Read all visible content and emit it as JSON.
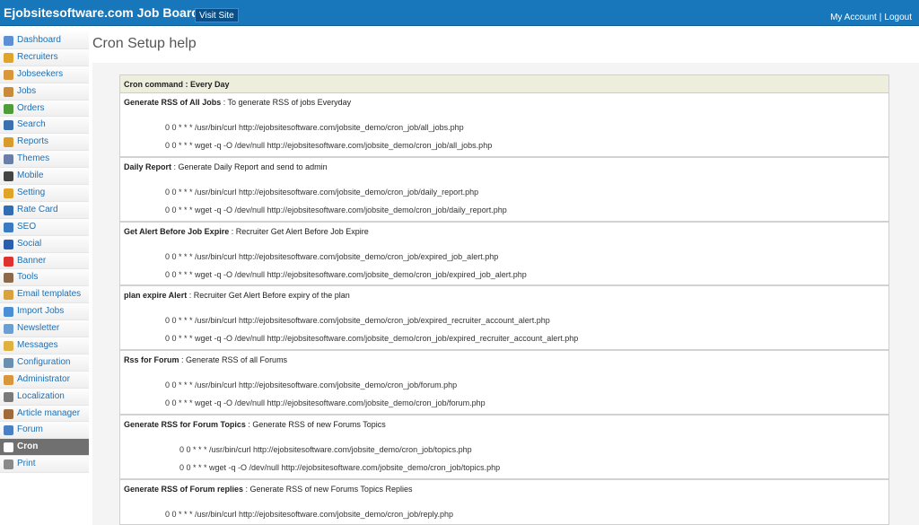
{
  "header": {
    "brand": "Ejobsitesoftware.com Job Board",
    "visit_site": "Visit Site",
    "my_account": "My Account",
    "separator": "|",
    "logout": "Logout"
  },
  "sidebar": {
    "items": [
      {
        "label": "Dashboard",
        "icon": "home-icon",
        "color": "#5b8fd6"
      },
      {
        "label": "Recruiters",
        "icon": "recruiter-icon",
        "color": "#e0a526"
      },
      {
        "label": "Jobseekers",
        "icon": "jobseekers-icon",
        "color": "#d9963a"
      },
      {
        "label": "Jobs",
        "icon": "jobs-icon",
        "color": "#c98a3a"
      },
      {
        "label": "Orders",
        "icon": "orders-icon",
        "color": "#4f9d3a"
      },
      {
        "label": "Search",
        "icon": "search-icon",
        "color": "#3a6fb0"
      },
      {
        "label": "Reports",
        "icon": "reports-icon",
        "color": "#d99b2a"
      },
      {
        "label": "Themes",
        "icon": "themes-icon",
        "color": "#6a7fa8"
      },
      {
        "label": "Mobile",
        "icon": "mobile-icon",
        "color": "#444444"
      },
      {
        "label": "Setting",
        "icon": "gear-icon",
        "color": "#e0a526"
      },
      {
        "label": "Rate Card",
        "icon": "dollar-icon",
        "color": "#2f6db5"
      },
      {
        "label": "SEO",
        "icon": "seo-icon",
        "color": "#3a7cc4"
      },
      {
        "label": "Social",
        "icon": "social-icon",
        "color": "#2a5fb0"
      },
      {
        "label": "Banner",
        "icon": "banner-icon",
        "color": "#e03030"
      },
      {
        "label": "Tools",
        "icon": "tools-icon",
        "color": "#8a6a4a"
      },
      {
        "label": "Email templates",
        "icon": "email-icon",
        "color": "#d9a23a"
      },
      {
        "label": "Import Jobs",
        "icon": "import-icon",
        "color": "#4a8fd6"
      },
      {
        "label": "Newsletter",
        "icon": "newsletter-icon",
        "color": "#6a9fd6"
      },
      {
        "label": "Messages",
        "icon": "messages-icon",
        "color": "#e0b040"
      },
      {
        "label": "Configuration",
        "icon": "configuration-icon",
        "color": "#6a8fb0"
      },
      {
        "label": "Administrator",
        "icon": "administrator-icon",
        "color": "#d9963a"
      },
      {
        "label": "Localization",
        "icon": "localization-icon",
        "color": "#7a7a7a"
      },
      {
        "label": "Article manager",
        "icon": "article-icon",
        "color": "#a06a3a"
      },
      {
        "label": "Forum",
        "icon": "forum-icon",
        "color": "#4a7fc4"
      },
      {
        "label": "Cron",
        "icon": "clock-icon",
        "color": "#ffffff",
        "active": true
      },
      {
        "label": "Print",
        "icon": "print-icon",
        "color": "#8a8a8a"
      }
    ]
  },
  "main": {
    "title": "Cron Setup help",
    "table_header": "Cron command : Every Day",
    "jobs": [
      {
        "name": "Generate RSS of All Jobs",
        "desc": " : To generate RSS of jobs Everyday",
        "cmd_curl": "0 0 * * * /usr/bin/curl http://ejobsitesoftware.com/jobsite_demo/cron_job/all_jobs.php",
        "cmd_wget": "0 0 * * * wget -q -O /dev/null http://ejobsitesoftware.com/jobsite_demo/cron_job/all_jobs.php"
      },
      {
        "name": "Daily Report",
        "desc": " : Generate Daily Report and send to admin",
        "cmd_curl": "0 0 * * * /usr/bin/curl http://ejobsitesoftware.com/jobsite_demo/cron_job/daily_report.php",
        "cmd_wget": "0 0 * * * wget -q -O /dev/null http://ejobsitesoftware.com/jobsite_demo/cron_job/daily_report.php"
      },
      {
        "name": "Get Alert Before Job Expire",
        "desc": " : Recruiter Get Alert Before Job Expire",
        "cmd_curl": "0 0 * * * /usr/bin/curl http://ejobsitesoftware.com/jobsite_demo/cron_job/expired_job_alert.php",
        "cmd_wget": "0 0 * * * wget -q -O /dev/null http://ejobsitesoftware.com/jobsite_demo/cron_job/expired_job_alert.php"
      },
      {
        "name": "plan expire Alert",
        "desc": " : Recruiter Get Alert Before expiry of the plan",
        "cmd_curl": "0 0 * * * /usr/bin/curl http://ejobsitesoftware.com/jobsite_demo/cron_job/expired_recruiter_account_alert.php",
        "cmd_wget": "0 0 * * * wget -q -O /dev/null http://ejobsitesoftware.com/jobsite_demo/cron_job/expired_recruiter_account_alert.php"
      },
      {
        "name": "Rss for Forum",
        "desc": " : Generate RSS of all Forums",
        "cmd_curl": "0 0 * * * /usr/bin/curl http://ejobsitesoftware.com/jobsite_demo/cron_job/forum.php",
        "cmd_wget": "0 0 * * * wget -q -O /dev/null http://ejobsitesoftware.com/jobsite_demo/cron_job/forum.php"
      },
      {
        "name": "Generate RSS for Forum Topics",
        "desc": " : Generate RSS of new Forums Topics",
        "cmd_curl": "0 0 * * * /usr/bin/curl http://ejobsitesoftware.com/jobsite_demo/cron_job/topics.php",
        "cmd_wget": "0 0 * * * wget -q -O /dev/null http://ejobsitesoftware.com/jobsite_demo/cron_job/topics.php"
      },
      {
        "name": "Generate RSS of Forum replies",
        "desc": " : Generate RSS of new Forums Topics Replies",
        "cmd_curl": "0 0 * * * /usr/bin/curl http://ejobsitesoftware.com/jobsite_demo/cron_job/reply.php",
        "cmd_wget": ""
      }
    ]
  }
}
